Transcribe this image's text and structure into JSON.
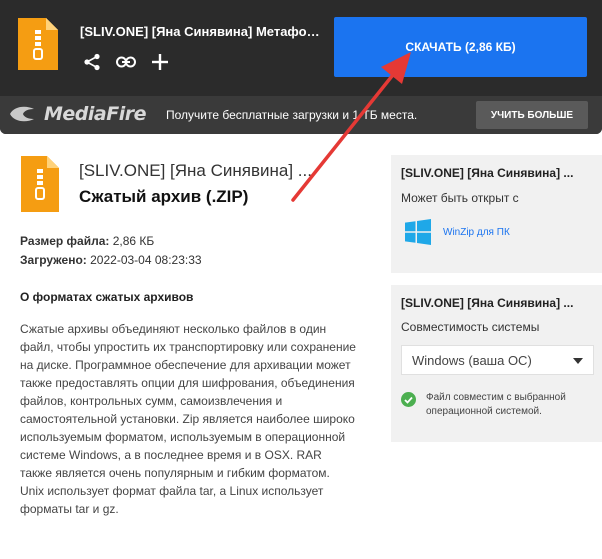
{
  "header": {
    "title": "[SLIV.ONE] [Яна Синявина] Метафор...",
    "download_label": "СКАЧАТЬ (2,86 КБ)",
    "actions": [
      "share-icon",
      "link-icon",
      "plus-icon"
    ]
  },
  "promo_bar": {
    "logo_text": "MediaFire",
    "promo_text": "Получите бесплатные загрузки и 1 ТБ места.",
    "more_label": "УЧИТЬ БОЛЬШЕ"
  },
  "file": {
    "name": "[SLIV.ONE] [Яна Синявина] ...",
    "type": "Сжатый архив (.ZIP)",
    "size_label": "Размер файла:",
    "size_value": "2,86 КБ",
    "uploaded_label": "Загружено:",
    "uploaded_value": "2022-03-04 08:23:33"
  },
  "about": {
    "title": "О форматах сжатых архивов",
    "text": "Сжатые архивы объединяют несколько файлов в один файл, чтобы упростить их транспортировку или сохранение на диске. Программное обеспечение для архивации может также предоставлять опции для шифрования, объединения файлов, контрольных сумм, самоизвлечения и самостоятельной установки. Zip является наиболее широко используемым форматом, используемым в операционной системе Windows, а в последнее время и в OSX. RAR также является очень популярным и гибким форматом. Unix использует формат файла tar, а Linux использует форматы tar и gz."
  },
  "open_card": {
    "title": "[SLIV.ONE] [Яна Синявина] ...",
    "subtitle": "Может быть открыт с",
    "app_label": "WinZip для ПК"
  },
  "compat_card": {
    "title": "[SLIV.ONE] [Яна Синявина] ...",
    "subtitle": "Совместимость системы",
    "selected_os": "Windows (ваша ОС)",
    "compat_text": "Файл совместим с выбранной операционной системой."
  },
  "colors": {
    "accent": "#1b74f0",
    "header_bg": "#2b2b2b",
    "bar_bg": "#3a3a3a",
    "zip_orange": "#f59d12",
    "check_green": "#4caf50",
    "annotation_arrow": "#e53935"
  }
}
